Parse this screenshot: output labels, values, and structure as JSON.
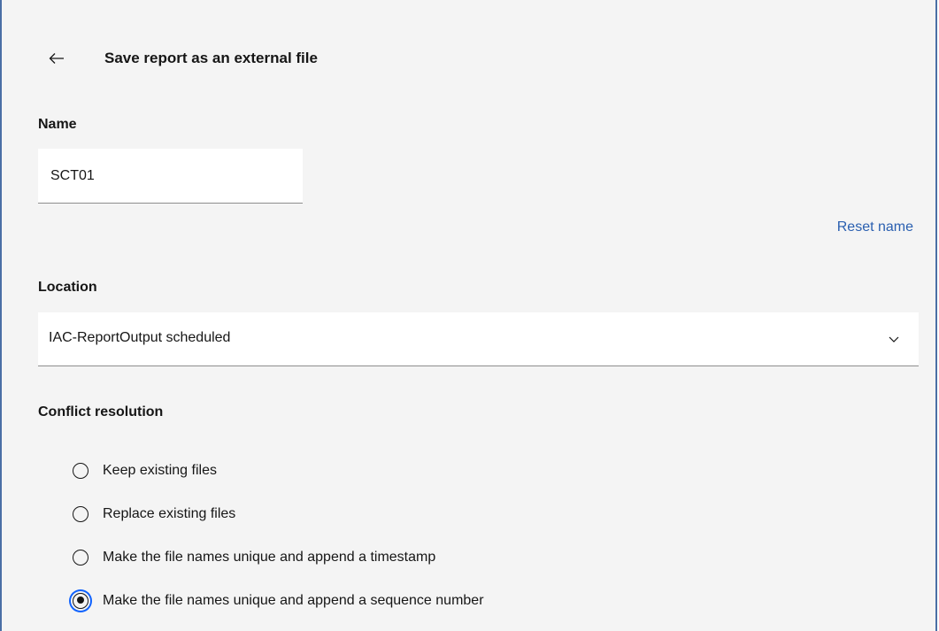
{
  "header": {
    "title": "Save report as an external file"
  },
  "name": {
    "label": "Name",
    "value": "SCT01",
    "reset_label": "Reset name"
  },
  "location": {
    "label": "Location",
    "selected": "IAC-ReportOutput scheduled"
  },
  "conflict": {
    "label": "Conflict resolution",
    "options": [
      {
        "label": "Keep existing files",
        "selected": false
      },
      {
        "label": "Replace existing files",
        "selected": false
      },
      {
        "label": "Make the file names unique and append a timestamp",
        "selected": false
      },
      {
        "label": "Make the file names unique and append a sequence number",
        "selected": true
      }
    ]
  },
  "colors": {
    "panel_background": "#f4f4f4",
    "link": "#2a5fb0",
    "focus_ring": "#0f62fe",
    "frame_border": "#4a6fa5"
  },
  "icons": {
    "back": "arrow-left-icon",
    "dropdown": "chevron-down-icon"
  }
}
